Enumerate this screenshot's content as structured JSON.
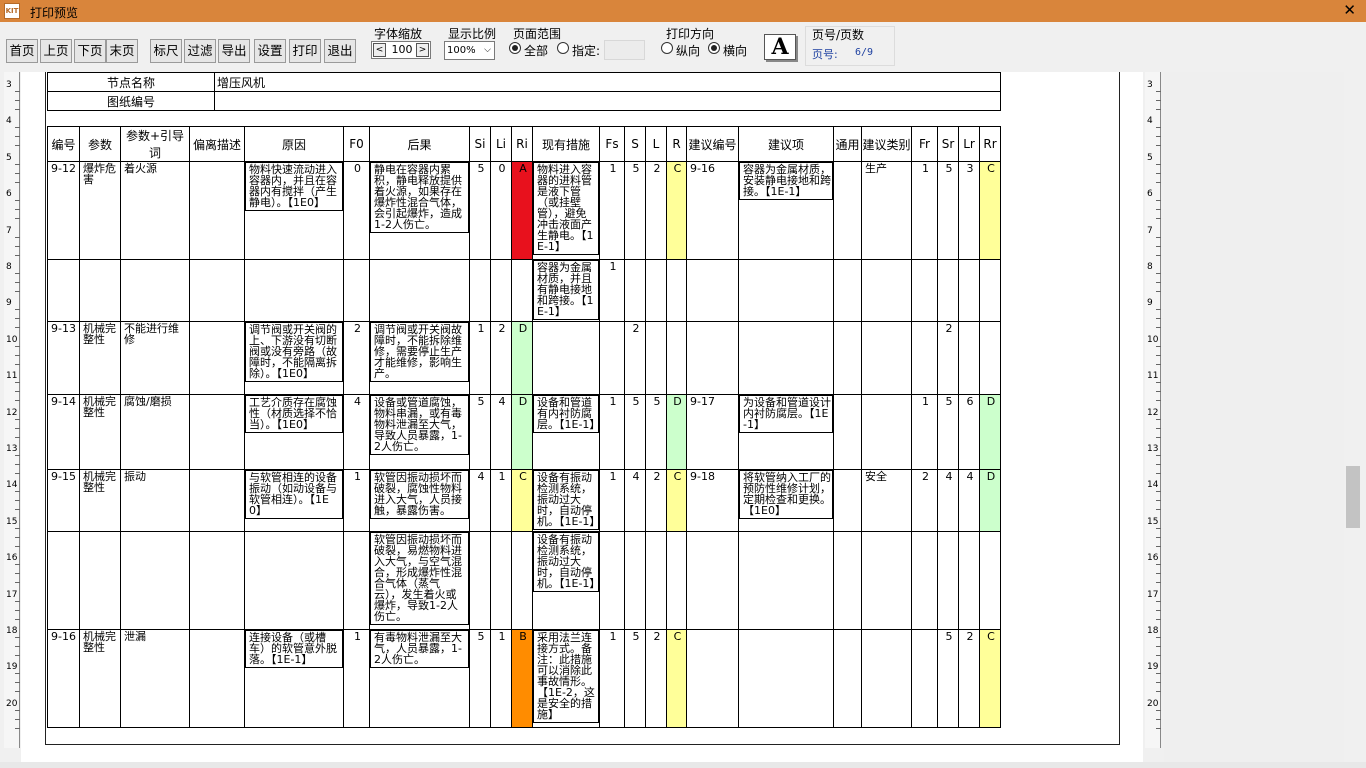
{
  "window": {
    "title": "打印预览",
    "icon_text": "KIT",
    "close": "✕"
  },
  "toolbar": {
    "buttons": [
      "首页",
      "上页",
      "下页",
      "末页",
      "标尺",
      "过滤",
      "导出",
      "设置",
      "打印",
      "退出"
    ],
    "font_scale": {
      "label": "字体缩放",
      "value": "100",
      "dec": "<",
      "inc": ">"
    },
    "display_ratio": {
      "label": "显示比例",
      "value": "100%"
    },
    "page_range": {
      "label": "页面范围",
      "all": "全部",
      "specify": "指定:",
      "selected": "all"
    },
    "orientation": {
      "label": "打印方向",
      "portrait": "纵向",
      "landscape": "横向",
      "selected": "landscape"
    },
    "font_icon": "A",
    "page_info": {
      "label": "页号/页数",
      "page_label": "页号:",
      "page_value": "6/9"
    }
  },
  "ruler_left": [
    "3",
    "4",
    "5",
    "6",
    "7",
    "8",
    "9",
    "10",
    "11",
    "12",
    "13",
    "14",
    "15",
    "16",
    "17",
    "18",
    "19",
    "20"
  ],
  "ruler_right": [
    "3",
    "4",
    "5",
    "6",
    "7",
    "8",
    "9",
    "10",
    "11",
    "12",
    "13",
    "14",
    "15",
    "16",
    "17",
    "18",
    "19",
    "20"
  ],
  "header_info": {
    "node_label": "节点名称",
    "node_value": "增压风机",
    "drawing_label": "图纸编号",
    "drawing_value": ""
  },
  "table": {
    "columns": [
      "编号",
      "参数",
      "参数+引导词",
      "偏离描述",
      "原因",
      "F0",
      "后果",
      "Si",
      "Li",
      "Ri",
      "现有措施",
      "Fs",
      "S",
      "L",
      "R",
      "建议编号",
      "建议项",
      "通用",
      "建议类别",
      "Fr",
      "Sr",
      "Lr",
      "Rr"
    ],
    "rows": [
      {
        "no": "9-12",
        "param": "爆炸危害",
        "guide": "着火源",
        "dev": "",
        "cause": "物料快速流动进入容器内，并且在容器内有搅拌（产生静电）。【1E0】",
        "f0": "0",
        "conseq": "静电在容器内累积，静电释放提供着火源，如果存在爆炸性混合气体，会引起爆炸，造成1-2人伤亡。",
        "si": "5",
        "li": "0",
        "ri": "A",
        "ri_color": "#e8111d",
        "measure": "物料进入容器的进料管是液下管（或挂壁管），避免冲击液面产生静电。【1E-1】",
        "fs": "1",
        "s": "5",
        "l": "2",
        "r": "C",
        "r_color": "#ffff99",
        "sug_no": "9-16",
        "sug": "容器为金属材质，安装静电接地和跨接。【1E-1】",
        "gen": "",
        "cat": "生产",
        "fr": "1",
        "sr": "5",
        "lr": "3",
        "rr": "C",
        "rr_color": "#ffff99"
      },
      {
        "no": "",
        "param": "",
        "guide": "",
        "dev": "",
        "cause": "",
        "f0": "",
        "conseq": "",
        "si": "",
        "li": "",
        "ri": "",
        "ri_color": "",
        "measure": "容器为金属材质，并且有静电接地和跨接。【1E-1】",
        "fs": "1",
        "s": "",
        "l": "",
        "r": "",
        "r_color": "",
        "sug_no": "",
        "sug": "",
        "gen": "",
        "cat": "",
        "fr": "",
        "sr": "",
        "lr": "",
        "rr": "",
        "rr_color": ""
      },
      {
        "no": "9-13",
        "param": "机械完整性",
        "guide": "不能进行维修",
        "dev": "",
        "cause": "调节阀或开关阀的上、下游没有切断阀或没有旁路（故障时，不能隔离拆除）。【1E0】",
        "f0": "2",
        "conseq": "调节阀或开关阀故障时，不能拆除维修，需要停止生产才能维修，影响生产。",
        "si": "1",
        "li": "2",
        "ri": "D",
        "ri_color": "#ccffcc",
        "measure": "",
        "fs": "",
        "s": "2",
        "l": "",
        "r": "",
        "r_color": "",
        "sug_no": "",
        "sug": "",
        "gen": "",
        "cat": "",
        "fr": "",
        "sr": "2",
        "lr": "",
        "rr": "",
        "rr_color": ""
      },
      {
        "no": "9-14",
        "param": "机械完整性",
        "guide": "腐蚀/磨损",
        "dev": "",
        "cause": "工艺介质存在腐蚀性（材质选择不恰当）。【1E0】",
        "f0": "4",
        "conseq": "设备或管道腐蚀，物料串漏，或有毒物料泄漏至大气，导致人员暴露，1-2人伤亡。",
        "si": "5",
        "li": "4",
        "ri": "D",
        "ri_color": "#ccffcc",
        "measure": "设备和管道有内衬防腐层。【1E-1】",
        "fs": "1",
        "s": "5",
        "l": "5",
        "r": "D",
        "r_color": "#ccffcc",
        "sug_no": "9-17",
        "sug": "为设备和管道设计内衬防腐层。【1E-1】",
        "gen": "",
        "cat": "",
        "fr": "1",
        "sr": "5",
        "lr": "6",
        "rr": "D",
        "rr_color": "#ccffcc"
      },
      {
        "no": "9-15",
        "param": "机械完整性",
        "guide": "振动",
        "dev": "",
        "cause": "与软管相连的设备振动（如动设备与软管相连）。【1E0】",
        "f0": "1",
        "conseq": "软管因振动损坏而破裂，腐蚀性物料进入大气，人员接触，暴露伤害。",
        "si": "4",
        "li": "1",
        "ri": "C",
        "ri_color": "#ffff99",
        "measure": "设备有振动检测系统，振动过大时，自动停机。【1E-1】",
        "fs": "1",
        "s": "4",
        "l": "2",
        "r": "C",
        "r_color": "#ffff99",
        "sug_no": "9-18",
        "sug": "将软管纳入工厂的预防性维修计划，定期检查和更换。【1E0】",
        "gen": "",
        "cat": "安全",
        "fr": "2",
        "sr": "4",
        "lr": "4",
        "rr": "D",
        "rr_color": "#ccffcc"
      },
      {
        "no": "",
        "param": "",
        "guide": "",
        "dev": "",
        "cause": "",
        "f0": "",
        "conseq": "软管因振动损坏而破裂，易燃物料进入大气，与空气混合，形成爆炸性混合气体（蒸气云），发生着火或爆炸，导致1-2人伤亡。",
        "si": "",
        "li": "",
        "ri": "",
        "ri_color": "",
        "measure": "设备有振动检测系统，振动过大时，自动停机。【1E-1】",
        "fs": "",
        "s": "",
        "l": "",
        "r": "",
        "r_color": "",
        "sug_no": "",
        "sug": "",
        "gen": "",
        "cat": "",
        "fr": "",
        "sr": "",
        "lr": "",
        "rr": "",
        "rr_color": ""
      },
      {
        "no": "9-16",
        "param": "机械完整性",
        "guide": "泄漏",
        "dev": "",
        "cause": "连接设备（或槽车）的软管意外脱落。【1E-1】",
        "f0": "1",
        "conseq": "有毒物料泄漏至大气，人员暴露，1-2人伤亡。",
        "si": "5",
        "li": "1",
        "ri": "B",
        "ri_color": "#ff8c00",
        "measure": "采用法兰连接方式。备注：此措施可以消除此事故情形。【1E-2，这是安全的措施】",
        "fs": "1",
        "s": "5",
        "l": "2",
        "r": "C",
        "r_color": "#ffff99",
        "sug_no": "",
        "sug": "",
        "gen": "",
        "cat": "",
        "fr": "",
        "sr": "5",
        "lr": "2",
        "rr": "C",
        "rr_color": "#ffff99"
      }
    ]
  }
}
